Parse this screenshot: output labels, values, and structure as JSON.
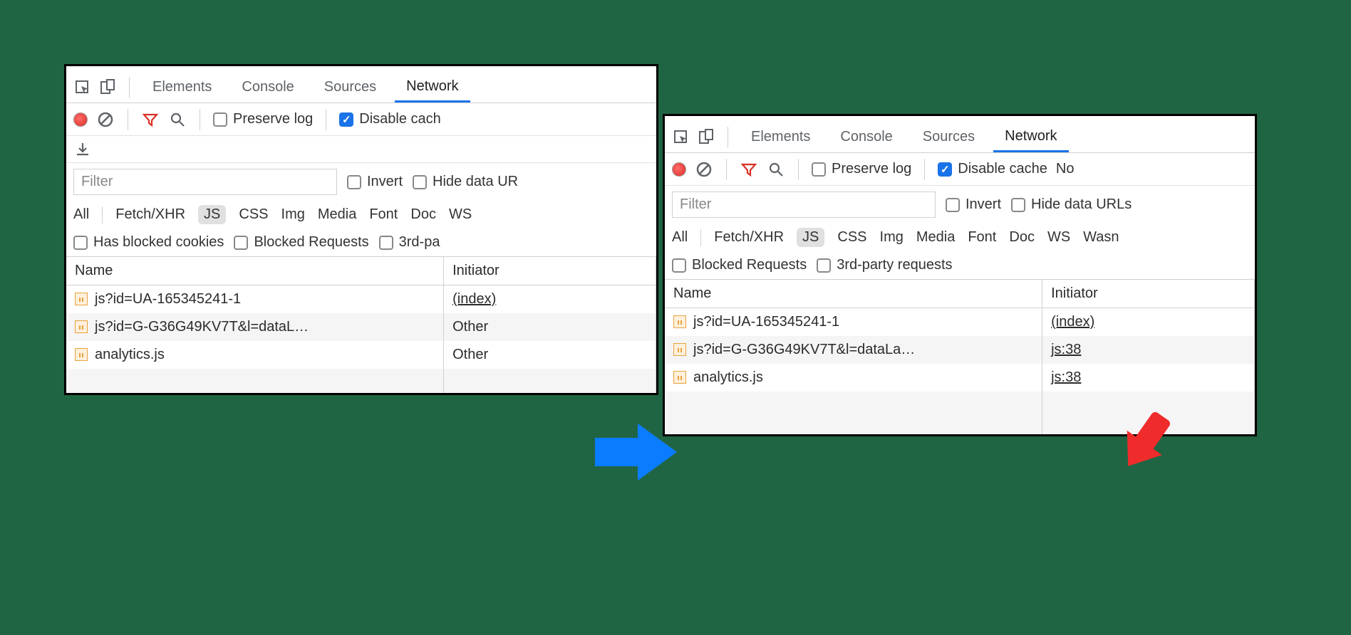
{
  "tabs": {
    "elements": "Elements",
    "console": "Console",
    "sources": "Sources",
    "network": "Network"
  },
  "toolbar": {
    "preserve": "Preserve log",
    "disable_cache": "Disable cache",
    "disable_cache_cut": "Disable cach",
    "no": "No"
  },
  "filter": {
    "placeholder": "Filter",
    "invert": "Invert",
    "hide_urls": "Hide data URLs",
    "hide_urls_cut": "Hide data UR"
  },
  "types": {
    "all": "All",
    "fetch": "Fetch/XHR",
    "js": "JS",
    "css": "CSS",
    "img": "Img",
    "media": "Media",
    "font": "Font",
    "doc": "Doc",
    "ws": "WS",
    "wasm": "Wasn"
  },
  "checks": {
    "has_blocked_cookies": "Has blocked cookies",
    "blocked_requests": "Blocked Requests",
    "third_party": "3rd-party requests",
    "third_party_cut": "3rd-pa"
  },
  "table": {
    "name": "Name",
    "initiator": "Initiator"
  },
  "left_rows": [
    {
      "name": "js?id=UA-165345241-1",
      "initiator": "(index)",
      "underline": true
    },
    {
      "name": "js?id=G-G36G49KV7T&l=dataL…",
      "initiator": "Other",
      "underline": false
    },
    {
      "name": "analytics.js",
      "initiator": "Other",
      "underline": false
    }
  ],
  "right_rows": [
    {
      "name": "js?id=UA-165345241-1",
      "initiator": "(index)",
      "underline": true
    },
    {
      "name": "js?id=G-G36G49KV7T&l=dataLa…",
      "initiator": "js:38",
      "underline": true
    },
    {
      "name": "analytics.js",
      "initiator": "js:38",
      "underline": true
    }
  ]
}
